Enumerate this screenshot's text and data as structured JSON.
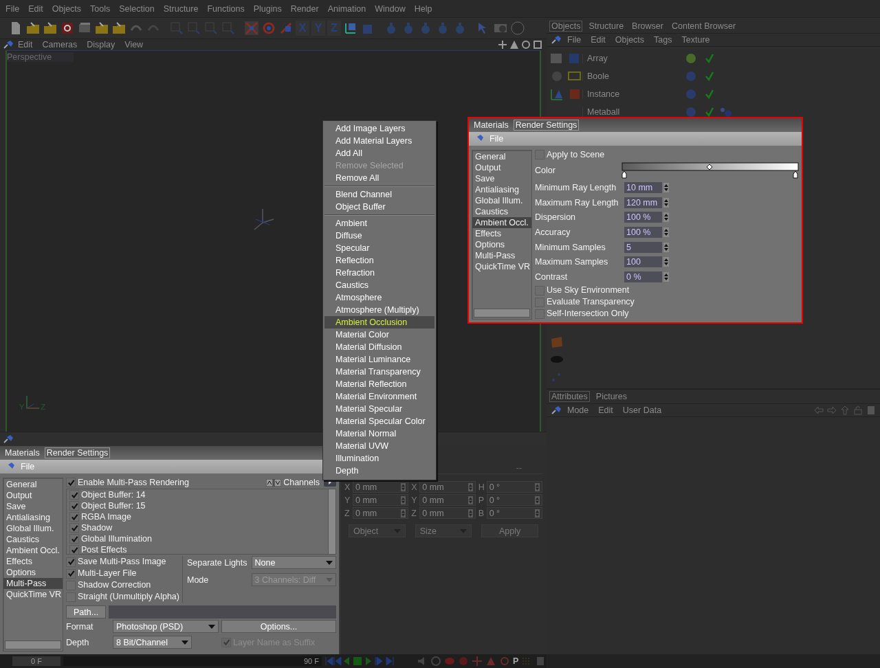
{
  "menu_bar": [
    "File",
    "Edit",
    "Objects",
    "Tools",
    "Selection",
    "Structure",
    "Functions",
    "Plugins",
    "Render",
    "Animation",
    "Window",
    "Help"
  ],
  "toolbar": {
    "axis_toggles": [
      "X",
      "Y",
      "Z"
    ]
  },
  "viewport": {
    "menu": [
      "Edit",
      "Cameras",
      "Display",
      "View"
    ],
    "title": "Perspective",
    "axis_labels": [
      "Y",
      "Z"
    ]
  },
  "context_menu": {
    "groups": [
      [
        {
          "label": "Add Image Layers",
          "disabled": false,
          "selected": false
        },
        {
          "label": "Add Material Layers",
          "disabled": false,
          "selected": false
        },
        {
          "label": "Add All",
          "disabled": false,
          "selected": false
        },
        {
          "label": "Remove Selected",
          "disabled": true,
          "selected": false
        },
        {
          "label": "Remove All",
          "disabled": false,
          "selected": false
        }
      ],
      [
        {
          "label": "Blend Channel",
          "disabled": false,
          "selected": false
        },
        {
          "label": "Object Buffer",
          "disabled": false,
          "selected": false
        }
      ],
      [
        {
          "label": "Ambient",
          "disabled": false,
          "selected": false
        },
        {
          "label": "Diffuse",
          "disabled": false,
          "selected": false
        },
        {
          "label": "Specular",
          "disabled": false,
          "selected": false
        },
        {
          "label": "Reflection",
          "disabled": false,
          "selected": false
        },
        {
          "label": "Refraction",
          "disabled": false,
          "selected": false
        },
        {
          "label": "Caustics",
          "disabled": false,
          "selected": false
        },
        {
          "label": "Atmosphere",
          "disabled": false,
          "selected": false
        },
        {
          "label": "Atmosphere (Multiply)",
          "disabled": false,
          "selected": false
        },
        {
          "label": "Ambient Occlusion",
          "disabled": false,
          "selected": true
        },
        {
          "label": "Material Color",
          "disabled": false,
          "selected": false
        },
        {
          "label": "Material Diffusion",
          "disabled": false,
          "selected": false
        },
        {
          "label": "Material Luminance",
          "disabled": false,
          "selected": false
        },
        {
          "label": "Material Transparency",
          "disabled": false,
          "selected": false
        },
        {
          "label": "Material Reflection",
          "disabled": false,
          "selected": false
        },
        {
          "label": "Material Environment",
          "disabled": false,
          "selected": false
        },
        {
          "label": "Material Specular",
          "disabled": false,
          "selected": false
        },
        {
          "label": "Material Specular Color",
          "disabled": false,
          "selected": false
        },
        {
          "label": "Material Normal",
          "disabled": false,
          "selected": false
        },
        {
          "label": "Material UVW",
          "disabled": false,
          "selected": false
        },
        {
          "label": "Illumination",
          "disabled": false,
          "selected": false
        },
        {
          "label": "Depth",
          "disabled": false,
          "selected": false
        }
      ]
    ]
  },
  "render_dialog": {
    "tabs": [
      {
        "label": "Materials",
        "selected": false
      },
      {
        "label": "Render Settings",
        "selected": true
      }
    ],
    "menu": [
      "File"
    ],
    "sidebar": [
      {
        "label": "General",
        "selected": false
      },
      {
        "label": "Output",
        "selected": false
      },
      {
        "label": "Save",
        "selected": false
      },
      {
        "label": "Antialiasing",
        "selected": false
      },
      {
        "label": "Global Illum.",
        "selected": false
      },
      {
        "label": "Caustics",
        "selected": false
      },
      {
        "label": "Ambient Occl.",
        "selected": true
      },
      {
        "label": "Effects",
        "selected": false
      },
      {
        "label": "Options",
        "selected": false
      },
      {
        "label": "Multi-Pass",
        "selected": false
      },
      {
        "label": "QuickTime VR",
        "selected": false
      }
    ],
    "apply_to_scene": {
      "label": "Apply to Scene",
      "checked": false
    },
    "color_label": "Color",
    "fields": [
      {
        "label": "Minimum Ray Length",
        "value": "10 mm"
      },
      {
        "label": "Maximum Ray Length",
        "value": "120 mm"
      },
      {
        "label": "Dispersion",
        "value": "100 %"
      },
      {
        "label": "Accuracy",
        "value": "100 %"
      },
      {
        "label": "Minimum Samples",
        "value": "5"
      },
      {
        "label": "Maximum Samples",
        "value": "100"
      },
      {
        "label": "Contrast",
        "value": "0 %"
      }
    ],
    "checkboxes": [
      {
        "label": "Use Sky Environment",
        "checked": false
      },
      {
        "label": "Evaluate Transparency",
        "checked": false
      },
      {
        "label": "Self-Intersection Only",
        "checked": false
      }
    ]
  },
  "render_settings": {
    "tabs": [
      {
        "label": "Materials",
        "selected": false
      },
      {
        "label": "Render Settings",
        "selected": true
      }
    ],
    "menu": [
      "File"
    ],
    "sidebar": [
      {
        "label": "General",
        "selected": false
      },
      {
        "label": "Output",
        "selected": false
      },
      {
        "label": "Save",
        "selected": false
      },
      {
        "label": "Antialiasing",
        "selected": false
      },
      {
        "label": "Global Illum.",
        "selected": false
      },
      {
        "label": "Caustics",
        "selected": false
      },
      {
        "label": "Ambient Occl.",
        "selected": false
      },
      {
        "label": "Effects",
        "selected": false
      },
      {
        "label": "Options",
        "selected": false
      },
      {
        "label": "Multi-Pass",
        "selected": true
      },
      {
        "label": "QuickTime VR",
        "selected": false
      }
    ],
    "enable": {
      "label": "Enable Multi-Pass Rendering",
      "checked": true
    },
    "channels_label": "Channels",
    "channels": [
      {
        "label": "Object Buffer: 14",
        "checked": true
      },
      {
        "label": "Object Buffer: 15",
        "checked": true
      },
      {
        "label": "RGBA Image",
        "checked": true
      },
      {
        "label": "Shadow",
        "checked": true
      },
      {
        "label": "Global Illumination",
        "checked": true
      },
      {
        "label": "Post Effects",
        "checked": true
      }
    ],
    "options": [
      {
        "label": "Save Multi-Pass Image",
        "checked": true
      },
      {
        "label": "Multi-Layer File",
        "checked": true
      },
      {
        "label": "Shadow Correction",
        "checked": false
      },
      {
        "label": "Straight (Unmultiply Alpha)",
        "checked": false
      }
    ],
    "separate_lights": {
      "label": "Separate Lights",
      "value": "None"
    },
    "mode": {
      "label": "Mode",
      "value": "3 Channels: Diff",
      "disabled": true
    },
    "path_button": "Path...",
    "format": {
      "label": "Format",
      "value": "Photoshop (PSD)"
    },
    "options_button": "Options...",
    "depth": {
      "label": "Depth",
      "value": "8 Bit/Channel"
    },
    "suffix": {
      "label": "Layer Name as Suffix",
      "checked": true,
      "disabled": true
    }
  },
  "coordinates": {
    "header": "--",
    "columns": [
      [
        {
          "axis": "X",
          "value": "0 mm"
        },
        {
          "axis": "Y",
          "value": "0 mm"
        },
        {
          "axis": "Z",
          "value": "0 mm"
        }
      ],
      [
        {
          "axis": "X",
          "value": "0 mm"
        },
        {
          "axis": "Y",
          "value": "0 mm"
        },
        {
          "axis": "Z",
          "value": "0 mm"
        }
      ],
      [
        {
          "axis": "H",
          "value": "0 °"
        },
        {
          "axis": "P",
          "value": "0 °"
        },
        {
          "axis": "B",
          "value": "0 °"
        }
      ]
    ],
    "dropdowns": [
      "Object",
      "Size"
    ],
    "apply": "Apply"
  },
  "objects_panel": {
    "tabs": [
      {
        "label": "Objects",
        "selected": true
      },
      {
        "label": "Structure",
        "selected": false
      },
      {
        "label": "Browser",
        "selected": false
      },
      {
        "label": "Content Browser",
        "selected": false
      }
    ],
    "menu": [
      "File",
      "Edit",
      "Objects",
      "Tags",
      "Texture"
    ],
    "objects": [
      {
        "name": "Array",
        "checked": true,
        "tag": false
      },
      {
        "name": "Boole",
        "checked": true,
        "tag": false
      },
      {
        "name": "Instance",
        "checked": true,
        "tag": false
      },
      {
        "name": "Metaball",
        "checked": true,
        "tag": true
      }
    ]
  },
  "attributes_panel": {
    "tabs": [
      {
        "label": "Attributes",
        "selected": true
      },
      {
        "label": "Pictures",
        "selected": false
      }
    ],
    "menu": [
      "Mode",
      "Edit",
      "User Data"
    ]
  },
  "timeline": {
    "start": "0 F",
    "end": "90 F",
    "key_button": "P"
  }
}
